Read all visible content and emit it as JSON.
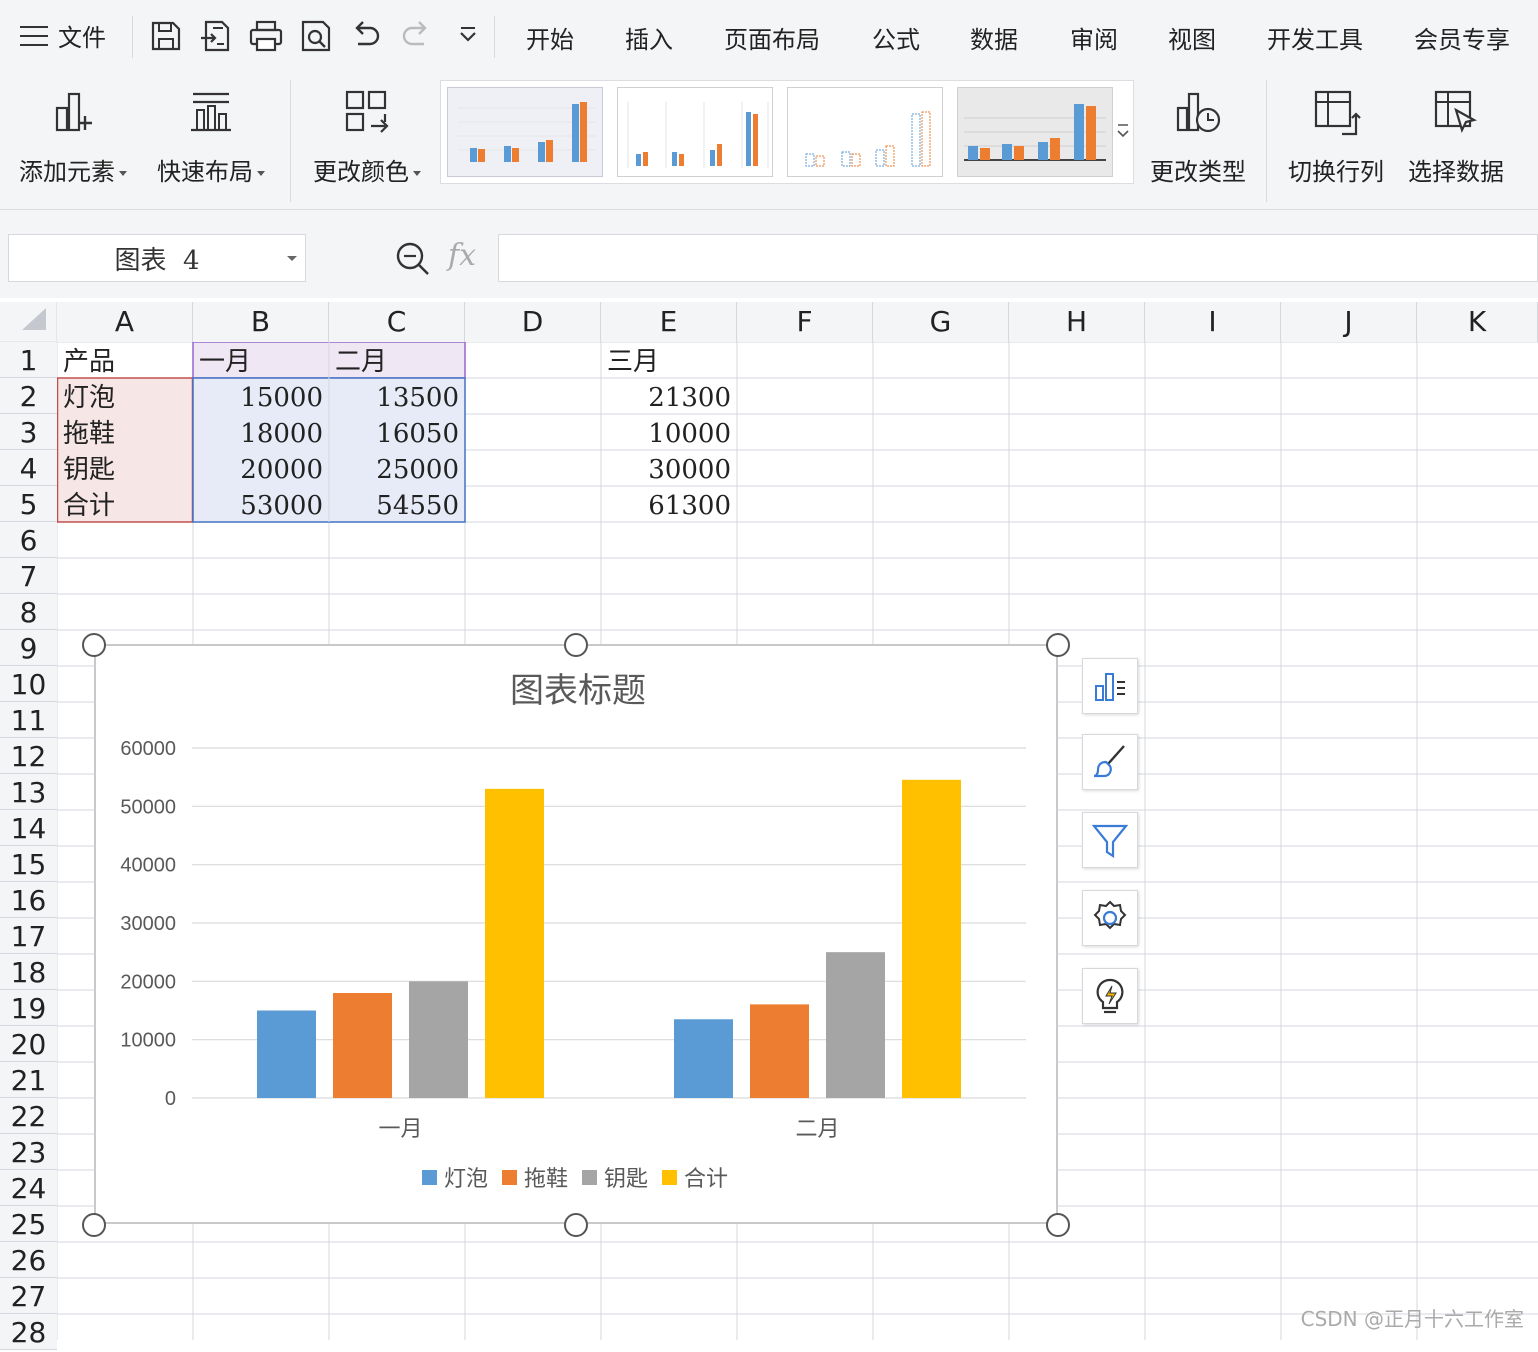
{
  "menubar": {
    "file_label": "文件",
    "tabs": [
      "开始",
      "插入",
      "页面布局",
      "公式",
      "数据",
      "审阅",
      "视图",
      "开发工具",
      "会员专享"
    ]
  },
  "quick_access": [
    "save-icon",
    "export-icon",
    "print-icon",
    "print-preview-icon",
    "undo-icon",
    "redo-icon",
    "more-icon"
  ],
  "ribbon": {
    "add_element": "添加元素",
    "quick_layout": "快速布局",
    "change_color": "更改颜色",
    "change_type": "更改类型",
    "switch_row_col": "切换行列",
    "select_data": "选择数据"
  },
  "namebox": {
    "value": "图表  4"
  },
  "formula_bar": {
    "fx_label": "fx",
    "value": ""
  },
  "columns": [
    "A",
    "B",
    "C",
    "D",
    "E",
    "F",
    "G",
    "H",
    "I",
    "J",
    "K"
  ],
  "rows": [
    "1",
    "2",
    "3",
    "4",
    "5",
    "6",
    "7",
    "8",
    "9",
    "10",
    "11",
    "12",
    "13",
    "14",
    "15",
    "16",
    "17",
    "18",
    "19",
    "20",
    "21",
    "22",
    "23",
    "24",
    "25",
    "26",
    "27",
    "28"
  ],
  "cells": {
    "A1": "产品",
    "B1": "一月",
    "C1": "二月",
    "E1": "三月",
    "A2": "灯泡",
    "B2": "15000",
    "C2": "13500",
    "E2": "21300",
    "A3": "拖鞋",
    "B3": "18000",
    "C3": "16050",
    "E3": "10000",
    "A4": "钥匙",
    "B4": "20000",
    "C4": "25000",
    "E4": "30000",
    "A5": "合计",
    "B5": "53000",
    "C5": "54550",
    "E5": "61300"
  },
  "chart_data": {
    "type": "bar",
    "title": "图表标题",
    "categories": [
      "一月",
      "二月"
    ],
    "series": [
      {
        "name": "灯泡",
        "values": [
          15000,
          13500
        ],
        "color": "#5b9bd5"
      },
      {
        "name": "拖鞋",
        "values": [
          18000,
          16050
        ],
        "color": "#ed7d31"
      },
      {
        "name": "钥匙",
        "values": [
          20000,
          25000
        ],
        "color": "#a5a5a5"
      },
      {
        "name": "合计",
        "values": [
          53000,
          54550
        ],
        "color": "#ffc000"
      }
    ],
    "ylim": [
      0,
      60000
    ],
    "yticks": [
      "0",
      "10000",
      "20000",
      "30000",
      "40000",
      "50000",
      "60000"
    ],
    "grid": true,
    "legend": "bottom"
  },
  "chart_side_tools": [
    "chart-elements-icon",
    "chart-style-brush-icon",
    "chart-filter-icon",
    "chart-settings-gear-icon",
    "chart-smart-lightbulb-icon"
  ],
  "watermark": "CSDN @正月十六工作室"
}
